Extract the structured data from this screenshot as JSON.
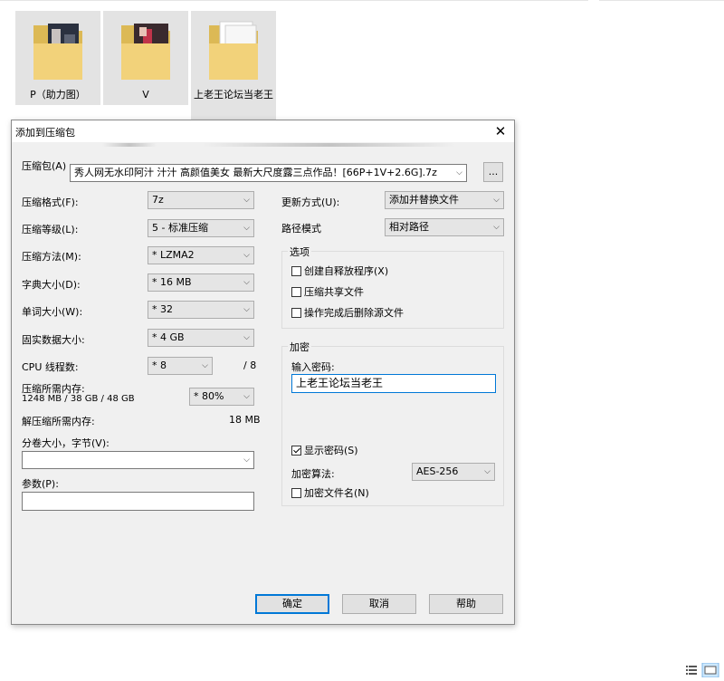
{
  "folders": [
    {
      "name": "P（助力图）"
    },
    {
      "name": "V"
    },
    {
      "name": "上老王论坛当老王"
    }
  ],
  "dialog": {
    "title": "添加到压缩包",
    "archive_label": "压缩包(A)",
    "archive_value": "秀人网无水印阿汁 汁汁 高颜值美女 最新大尺度露三点作品！[66P+1V+2.6G].7z",
    "browse_label": "...",
    "format_label": "压缩格式(F):",
    "format_value": "7z",
    "level_label": "压缩等级(L):",
    "level_value": "5 - 标准压缩",
    "method_label": "压缩方法(M):",
    "method_value": "* LZMA2",
    "dict_label": "字典大小(D):",
    "dict_value": "* 16 MB",
    "word_label": "单词大小(W):",
    "word_value": "* 32",
    "solid_label": "固实数据大小:",
    "solid_value": "* 4 GB",
    "cpu_label": "CPU 线程数:",
    "cpu_value": "* 8",
    "cpu_total": "/ 8",
    "mem_label": "压缩所需内存:",
    "mem_detail": "1248 MB / 38 GB / 48 GB",
    "mem_value": "* 80%",
    "unmem_label": "解压缩所需内存:",
    "unmem_value": "18 MB",
    "split_label": "分卷大小，字节(V):",
    "split_value": "",
    "params_label": "参数(P):",
    "params_value": "",
    "update_label": "更新方式(U):",
    "update_value": "添加并替换文件",
    "path_label": "路径模式",
    "path_value": "相对路径",
    "options": {
      "title": "选项",
      "sfx": "创建自释放程序(X)",
      "shared": "压缩共享文件",
      "delete": "操作完成后删除源文件"
    },
    "encryption": {
      "title": "加密",
      "pwd_label": "输入密码:",
      "pwd_value": "上老王论坛当老王",
      "show_pwd": "显示密码(S)",
      "method_label": "加密算法:",
      "method_value": "AES-256",
      "encrypt_names": "加密文件名(N)"
    },
    "ok": "确定",
    "cancel": "取消",
    "help": "帮助"
  }
}
